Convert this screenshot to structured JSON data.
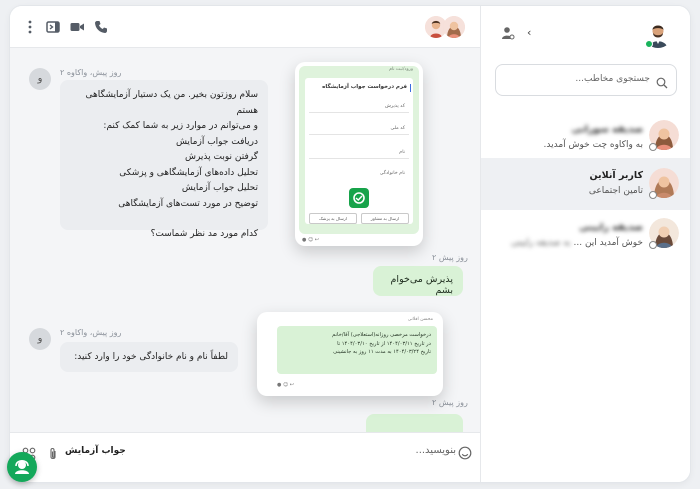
{
  "header": {
    "icons": [
      "more-vert-icon",
      "sidebar-toggle-icon",
      "video-icon",
      "phone-icon"
    ]
  },
  "messages": {
    "m1": {
      "sender_initial": "و",
      "meta": "۲ روز پیش، واکاوه",
      "lines": [
        "سلام روزتون بخیر. من یک دستیار آزمایشگاهی هستم",
        "و می‌توانم در موارد زیر به شما کمک کنم:",
        "دریافت جواب آزمایش",
        "گرفتن نوبت پذیرش",
        "تحلیل داده‌های آزمایشگاهی و پزشکی",
        "تحلیل جواب آزمایش",
        "توضیح در مورد تست‌های آزمایشگاهی",
        "",
        "کدام مورد مد نظر شماست؟"
      ]
    },
    "m2": {
      "meta": "۲ روز پیش",
      "text": "پذیرش می‌خوام بشم"
    },
    "m3": {
      "sender_initial": "و",
      "meta": "۲ روز پیش، واکاوه",
      "text": "لطفاً نام و نام خانوادگی خود را وارد کنید:"
    },
    "m4": {
      "meta": "۲ روز پیش"
    }
  },
  "overlay1": {
    "top_text": "ورود/ثبت نام",
    "title": "فرم درخواست جواب آزمایشگاه",
    "fields": [
      "کد پذیرش",
      "کد ملی",
      "نام",
      "نام خانوادگی"
    ],
    "btn_consult": "ارسال به مشاور",
    "btn_doctor": "ارسال به پزشک"
  },
  "overlay2": {
    "top_text": "محسن افلانی",
    "lines": [
      "درخواست مرخصی روزانه(استعلاجی) آقا/خانم",
      "در تاریخ ۱۴۰۴/۰۳/۱۱ از تاریخ ۱۴۰۴/۰۳/۱۰ تا",
      "تاریخ ۱۴۰۴/۰۳/۲۴ به مدت ۱۱ روز به جانشینی"
    ]
  },
  "composer": {
    "placeholder": "بنویسید...",
    "quick_action": "جواب آزمایش"
  },
  "sidebar": {
    "search_placeholder": "جستجوی مخاطب...",
    "contacts": [
      {
        "name": "صدیقه سورانی",
        "message": "به واکاوه چت خوش آمدید.",
        "name_blurred": true,
        "message_blur_prefix": ""
      },
      {
        "name": "کاربر آنلاین",
        "message": "تامین اجتماعی",
        "name_blurred": false,
        "message_blur_prefix": ""
      },
      {
        "name": "صدیقه رایینی",
        "message": "خوش آمدید این ...",
        "name_blurred": true,
        "message_blur_prefix": "به صدیقه رایینی"
      }
    ]
  },
  "colors": {
    "accent_green": "#14a85a",
    "bubble_out": "#d9f2d6",
    "bubble_in": "#ebedf0"
  }
}
